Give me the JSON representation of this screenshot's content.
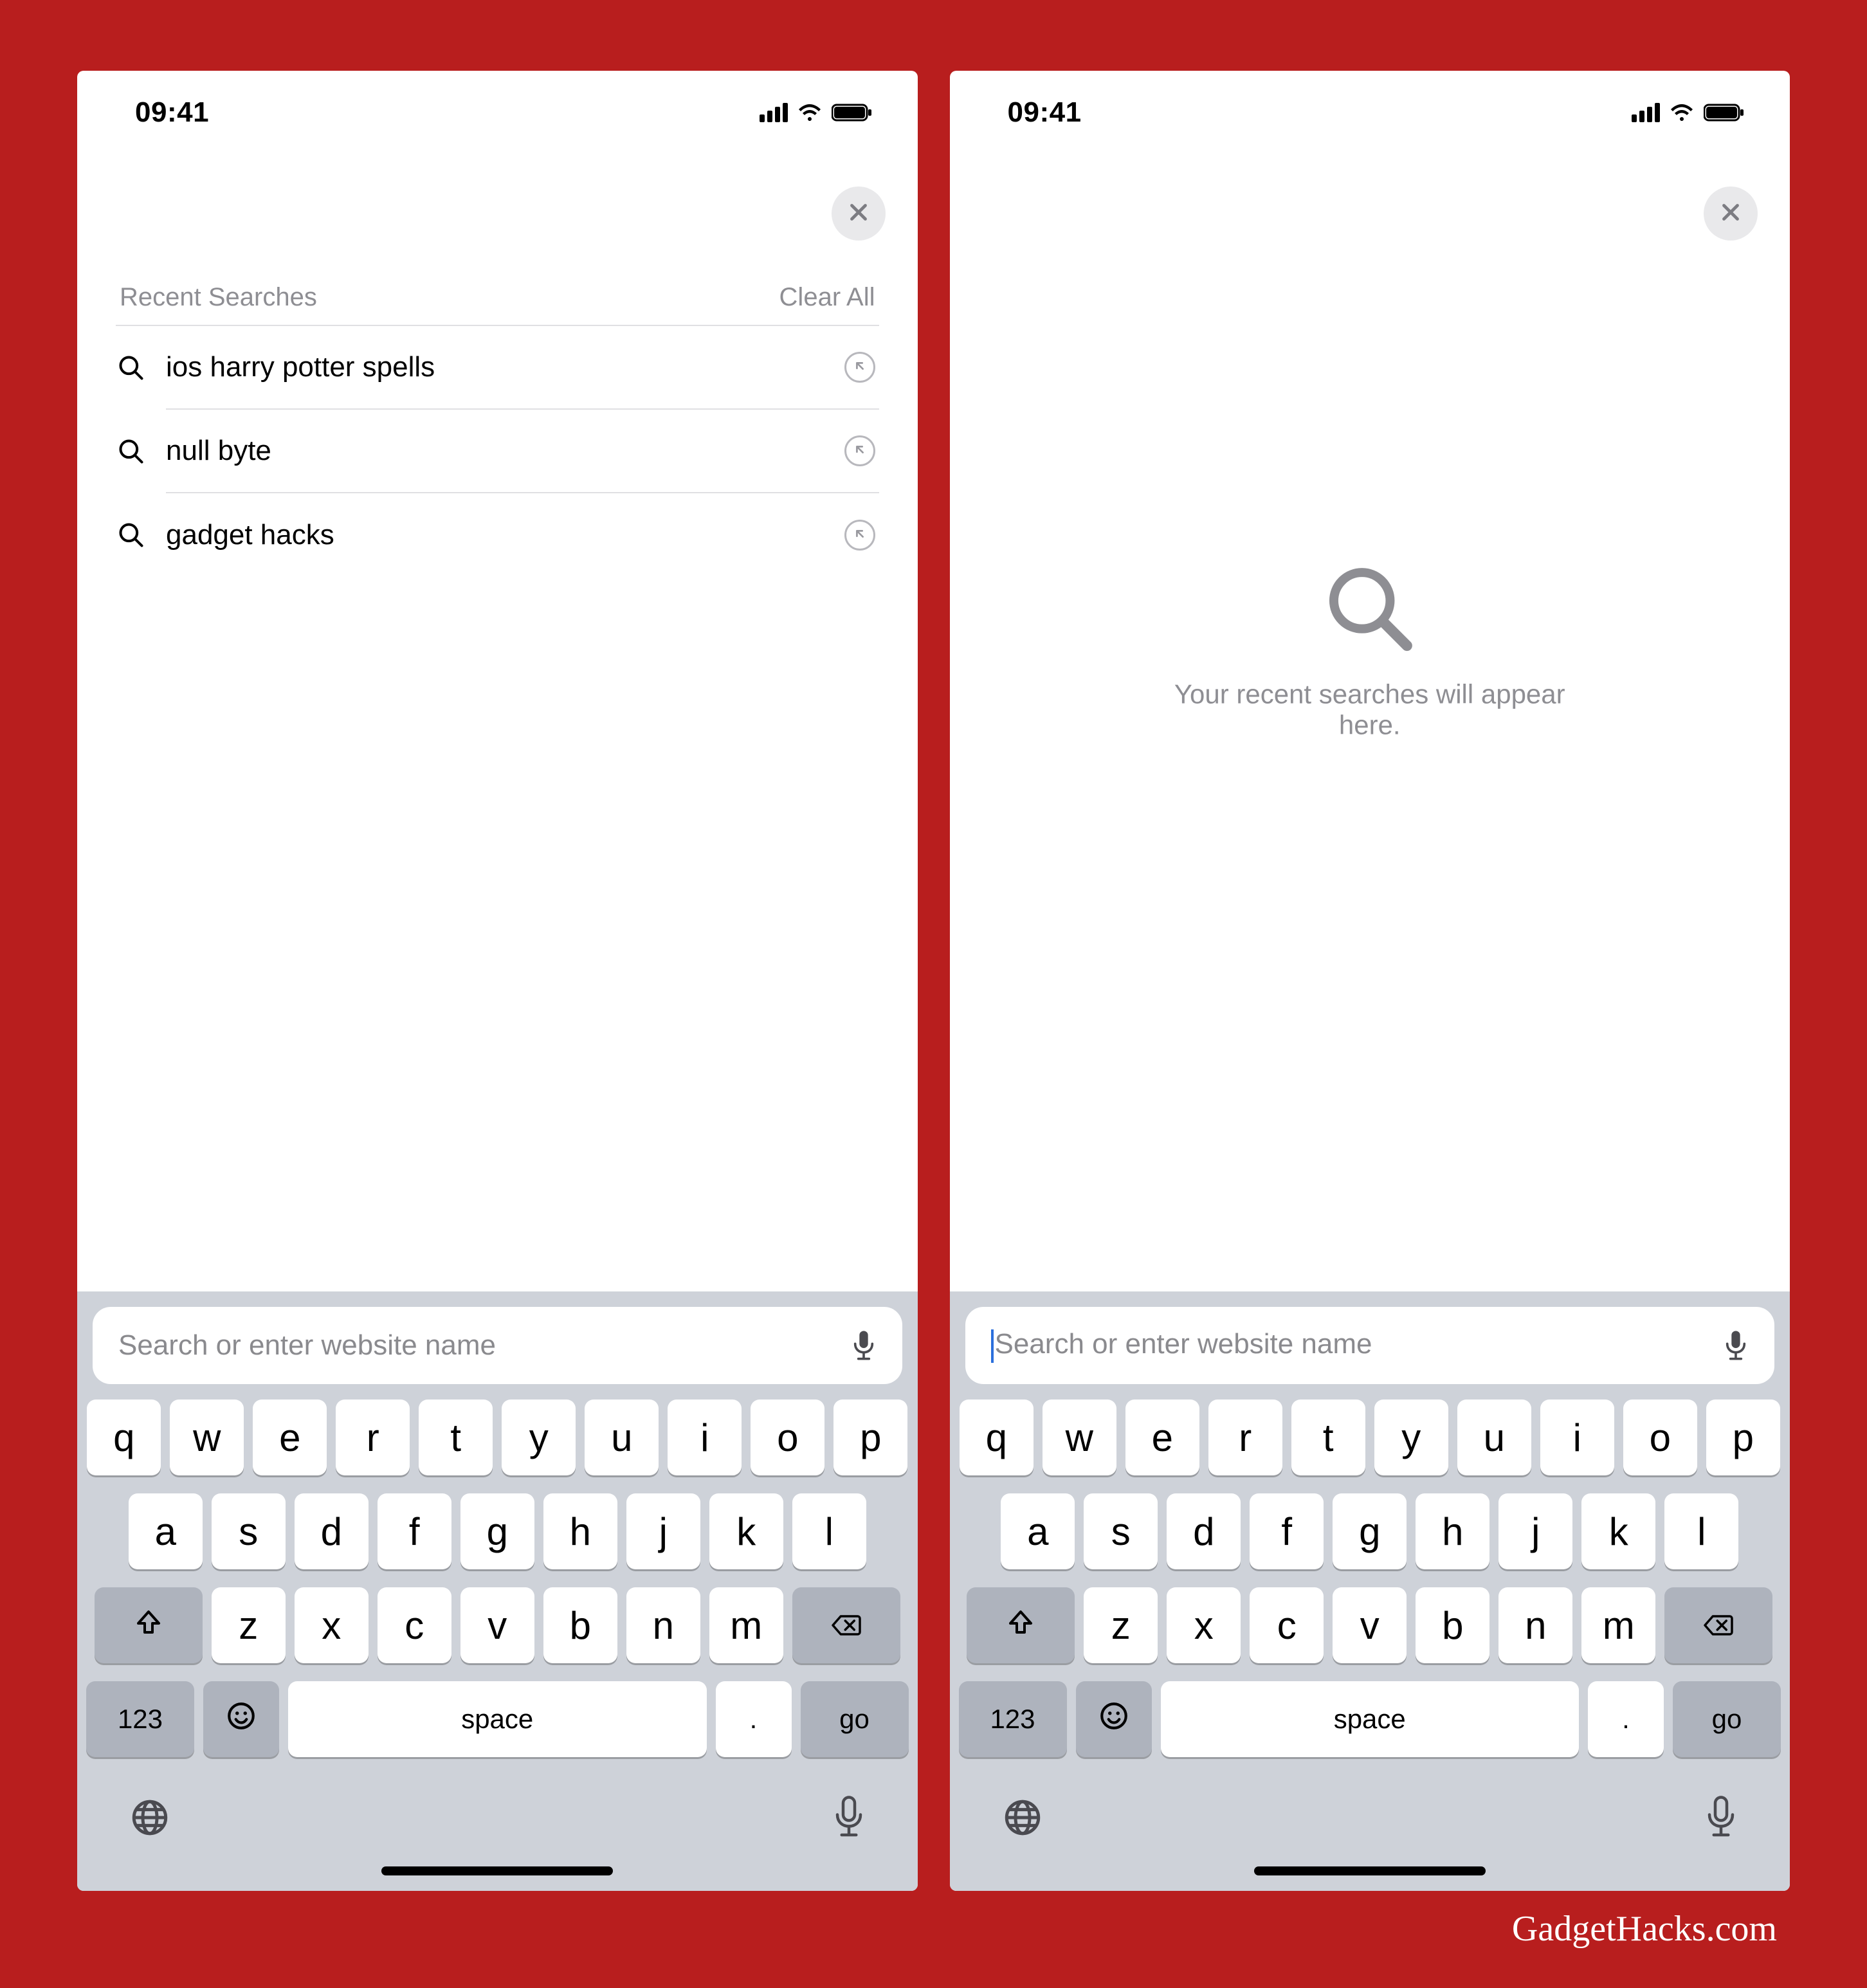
{
  "status": {
    "time": "09:41"
  },
  "left": {
    "recent_title": "Recent Searches",
    "clear_all": "Clear All",
    "items": [
      {
        "label": "ios harry potter spells"
      },
      {
        "label": "null byte"
      },
      {
        "label": "gadget hacks"
      }
    ]
  },
  "right": {
    "empty_message": "Your recent searches will appear here."
  },
  "urlbar": {
    "placeholder": "Search or enter website name"
  },
  "keyboard": {
    "row1": [
      "q",
      "w",
      "e",
      "r",
      "t",
      "y",
      "u",
      "i",
      "o",
      "p"
    ],
    "row2": [
      "a",
      "s",
      "d",
      "f",
      "g",
      "h",
      "j",
      "k",
      "l"
    ],
    "row3": [
      "z",
      "x",
      "c",
      "v",
      "b",
      "n",
      "m"
    ],
    "numkey": "123",
    "space": "space",
    "dot": ".",
    "go": "go"
  },
  "watermark": "GadgetHacks.com"
}
